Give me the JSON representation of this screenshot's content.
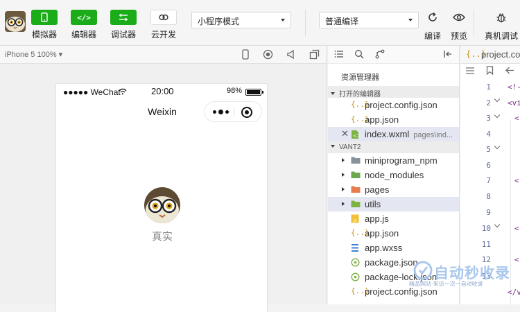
{
  "toolbar": {
    "simulator_label": "模拟器",
    "editor_label": "编辑器",
    "debugger_label": "调试器",
    "cloud_label": "云开发",
    "mode_select": "小程序模式",
    "compile_select": "普通编译",
    "compile_label": "编译",
    "preview_label": "预览",
    "real_debug_label": "真机调试",
    "editor_icon_text": "</>",
    "accent_color": "#1aad19"
  },
  "simulator": {
    "device_label": "iPhone 5 100% ▾",
    "status": {
      "carrier": "●●●●● WeChat",
      "time": "20:00",
      "battery_percent": "98%",
      "battery_level": 0.98
    },
    "nav_title": "Weixin",
    "profile_name": "真实"
  },
  "explorer": {
    "title": "资源管理器",
    "open_editors_header": "打开的编辑器",
    "open_editors": [
      {
        "icon": "{..}",
        "name": "project.config.json"
      },
      {
        "icon": "{..}",
        "name": "app.json"
      },
      {
        "icon": "wxml",
        "name": "index.wxml",
        "path": "pages\\ind..."
      }
    ],
    "project_header": "VANT2",
    "project_items": [
      {
        "type": "folder",
        "icon": "folder-gray",
        "name": "miniprogram_npm"
      },
      {
        "type": "folder",
        "icon": "folder-green",
        "name": "node_modules"
      },
      {
        "type": "folder",
        "icon": "folder-orange",
        "name": "pages"
      },
      {
        "type": "folder",
        "icon": "folder-green",
        "name": "utils"
      },
      {
        "type": "file",
        "icon": "js",
        "name": "app.js"
      },
      {
        "type": "file",
        "icon": "{..}",
        "name": "app.json"
      },
      {
        "type": "file",
        "icon": "wxss",
        "name": "app.wxss"
      },
      {
        "type": "file",
        "icon": "pkg",
        "name": "package.json"
      },
      {
        "type": "file",
        "icon": "pkg",
        "name": "package-lock.json"
      },
      {
        "type": "file",
        "icon": "{..}",
        "name": "project.config.json"
      }
    ]
  },
  "editor": {
    "tab_icon": "{..}",
    "tab_name": "project.co",
    "line_numbers": [
      "1",
      "2",
      "3",
      "4",
      "5",
      "6",
      "7",
      "8",
      "9",
      "10",
      "11",
      "12",
      "13"
    ],
    "code_fragments": [
      "<!-",
      "<vi",
      "<",
      "<",
      "<",
      "<",
      "</vi"
    ]
  },
  "watermark": {
    "text": "自动秒收录",
    "subtext": "精品网站·来访一次一自动收录"
  }
}
